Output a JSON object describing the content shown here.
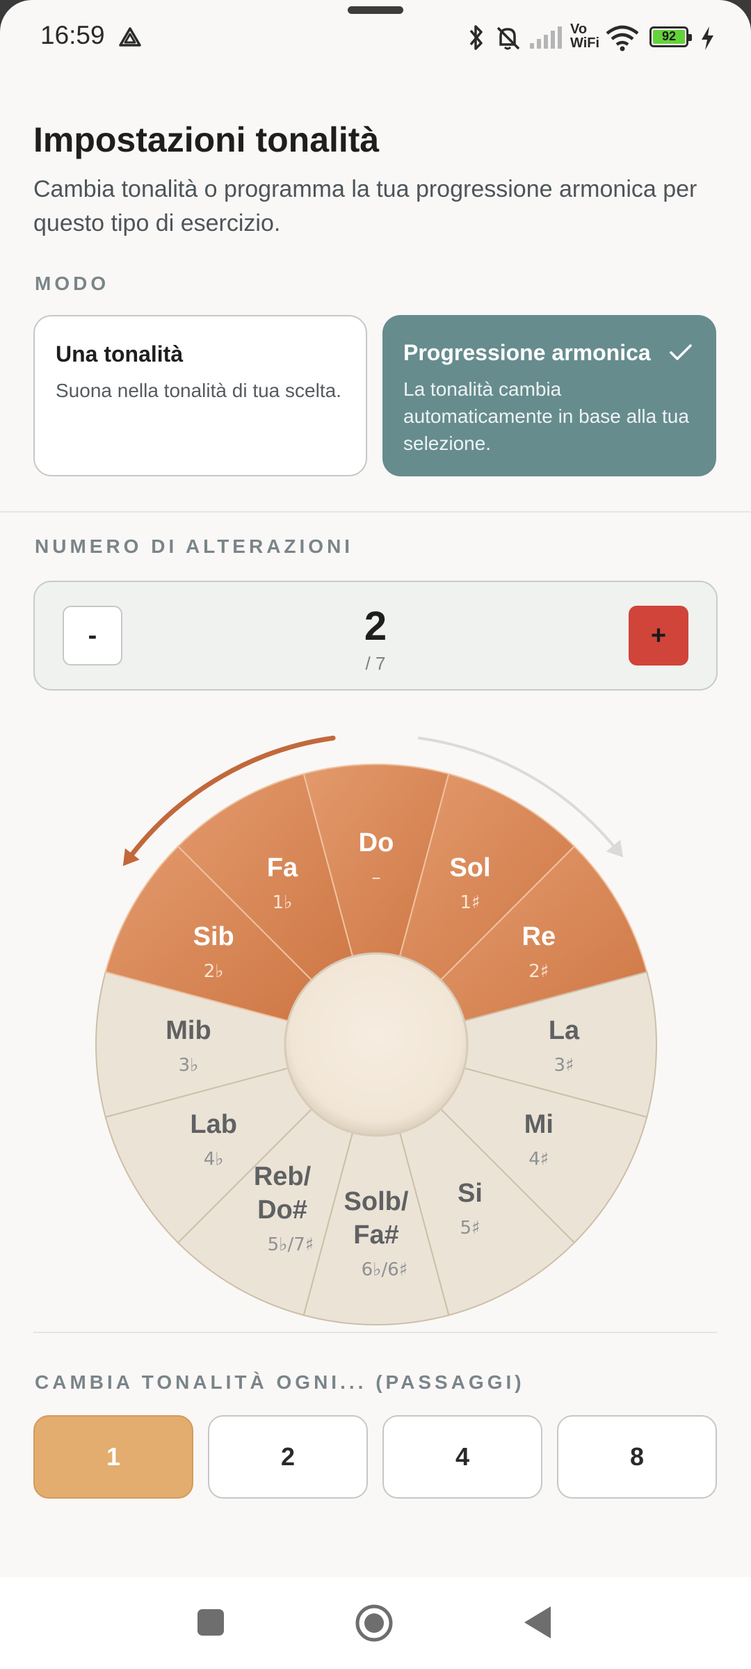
{
  "status_bar": {
    "time": "16:59",
    "battery": "92",
    "wifi_label_top": "Vo",
    "wifi_label_bottom": "WiFi"
  },
  "header": {
    "title": "Impostazioni tonalità",
    "subtitle": "Cambia tonalità o programma la tua progressione armonica per questo tipo di esercizio."
  },
  "mode": {
    "label": "MODO",
    "options": [
      {
        "title": "Una tonalità",
        "description": "Suona nella tonalità di tua scelta.",
        "selected": false
      },
      {
        "title": "Progressione armonica",
        "description": "La tonalità cambia automaticamente in base alla tua selezione.",
        "selected": true
      }
    ]
  },
  "accidentals": {
    "label": "NUMERO DI ALTERAZIONI",
    "minus_label": "-",
    "plus_label": "+",
    "value": "2",
    "max": "/ 7"
  },
  "circle": {
    "keys": [
      {
        "name": "Do",
        "acc": "–",
        "active": true
      },
      {
        "name": "Sol",
        "acc": "1♯",
        "active": true
      },
      {
        "name": "Re",
        "acc": "2♯",
        "active": true
      },
      {
        "name": "La",
        "acc": "3♯",
        "active": false
      },
      {
        "name": "Mi",
        "acc": "4♯",
        "active": false
      },
      {
        "name": "Si",
        "acc": "5♯",
        "active": false
      },
      {
        "name": "Solb/\nFa#",
        "acc": "6♭/6♯",
        "active": false
      },
      {
        "name": "Reb/\nDo#",
        "acc": "5♭/7♯",
        "active": false
      },
      {
        "name": "Lab",
        "acc": "4♭",
        "active": false
      },
      {
        "name": "Mib",
        "acc": "3♭",
        "active": false
      },
      {
        "name": "Sib",
        "acc": "2♭",
        "active": true
      },
      {
        "name": "Fa",
        "acc": "1♭",
        "active": true
      }
    ],
    "colors": {
      "active": "#db8a5b",
      "inactive": "#ebe3d6",
      "arrow_left": "#c2683b",
      "arrow_right": "#dadada"
    }
  },
  "change_every": {
    "label": "CAMBIA TONALITÀ OGNI... (PASSAGGI)",
    "options": [
      "1",
      "2",
      "4",
      "8"
    ],
    "selected": "1"
  },
  "colors": {
    "teal": "#668c8e",
    "red": "#d0443a",
    "amber": "#e2ad6f"
  }
}
